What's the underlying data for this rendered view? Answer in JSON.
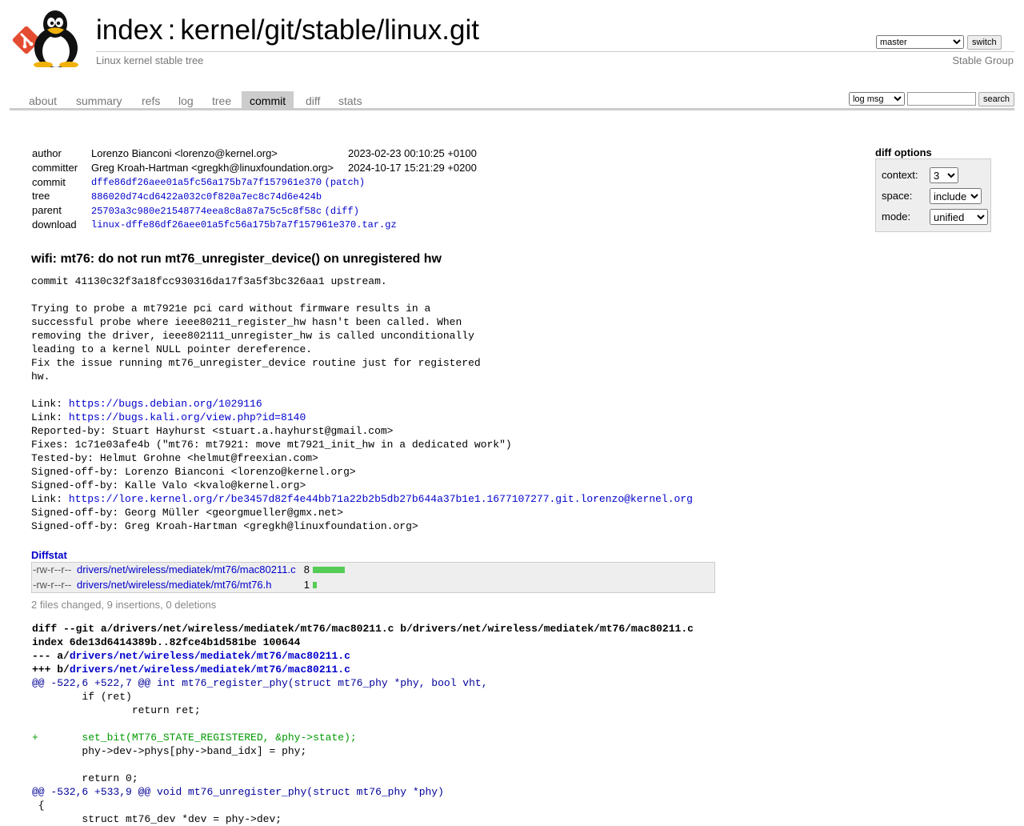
{
  "header": {
    "title_index": "index",
    "title_sep": ":",
    "title_repo": "kernel/git/stable/linux.git",
    "subtitle": "Linux kernel stable tree",
    "owner": "Stable Group",
    "branch_selected": "master",
    "switch_label": "switch"
  },
  "tabs": [
    {
      "label": "about"
    },
    {
      "label": "summary"
    },
    {
      "label": "refs"
    },
    {
      "label": "log"
    },
    {
      "label": "tree"
    },
    {
      "label": "commit"
    },
    {
      "label": "diff"
    },
    {
      "label": "stats"
    }
  ],
  "search": {
    "mode_selected": "log msg",
    "query": "",
    "button_label": "search"
  },
  "commit_info": {
    "author": {
      "label": "author",
      "value": "Lorenzo Bianconi <lorenzo@kernel.org>",
      "date": "2023-02-23 00:10:25 +0100"
    },
    "committer": {
      "label": "committer",
      "value": "Greg Kroah-Hartman <gregkh@linuxfoundation.org>",
      "date": "2024-10-17 15:21:29 +0200"
    },
    "commit": {
      "label": "commit",
      "hash": "dffe86df26aee01a5fc56a175b7a7f157961e370",
      "extra": "patch"
    },
    "tree": {
      "label": "tree",
      "hash": "886020d74cd6422a032c0f820a7ec8c74d6e424b"
    },
    "parent": {
      "label": "parent",
      "hash": "25703a3c980e21548774eea8c8a87a75c5c8f58c",
      "extra": "diff"
    },
    "download": {
      "label": "download",
      "file": "linux-dffe86df26aee01a5fc56a175b7a7f157961e370.tar.gz"
    }
  },
  "diff_options": {
    "title": "diff options",
    "context_label": "context:",
    "context_value": "3",
    "space_label": "space:",
    "space_value": "include",
    "mode_label": "mode:",
    "mode_value": "unified"
  },
  "subject": "wifi: mt76: do not run mt76_unregister_device() on unregistered hw",
  "message_lines": [
    "commit 41130c32f3a18fcc930316da17f3a5f3bc326aa1 upstream.",
    "",
    "Trying to probe a mt7921e pci card without firmware results in a",
    "successful probe where ieee80211_register_hw hasn't been called. When",
    "removing the driver, ieee802111_unregister_hw is called unconditionally",
    "leading to a kernel NULL pointer dereference.",
    "Fix the issue running mt76_unregister_device routine just for registered",
    "hw.",
    "",
    "Link: |https://bugs.debian.org/1029116",
    "Link: |https://bugs.kali.org/view.php?id=8140",
    "Reported-by: Stuart Hayhurst <stuart.a.hayhurst@gmail.com>",
    "Fixes: 1c71e03afe4b (\"mt76: mt7921: move mt7921_init_hw in a dedicated work\")",
    "Tested-by: Helmut Grohne <helmut@freexian.com>",
    "Signed-off-by: Lorenzo Bianconi <lorenzo@kernel.org>",
    "Signed-off-by: Kalle Valo <kvalo@kernel.org>",
    "Link: |https://lore.kernel.org/r/be3457d82f4e44bb71a22b2b5db27b644a37b1e1.1677107277.git.lorenzo@kernel.org",
    "Signed-off-by: Georg Müller <georgmueller@gmx.net>",
    "Signed-off-by: Greg Kroah-Hartman <gregkh@linuxfoundation.org>"
  ],
  "diffstat": {
    "title": "Diffstat",
    "files": [
      {
        "mode": "-rw-r--r--",
        "path": "drivers/net/wireless/mediatek/mt76/mac80211.c",
        "count": "8",
        "insertions": 8
      },
      {
        "mode": "-rw-r--r--",
        "path": "drivers/net/wireless/mediatek/mt76/mt76.h",
        "count": "1",
        "insertions": 1
      }
    ],
    "summary": "2 files changed, 9 insertions, 0 deletions",
    "bar_color": "#55cc55"
  },
  "diff_lines": [
    {
      "type": "head",
      "text": "diff --git a/drivers/net/wireless/mediatek/mt76/mac80211.c b/drivers/net/wireless/mediatek/mt76/mac80211.c"
    },
    {
      "type": "head",
      "text": "index 6de13d6414389b..82fce4b1d581be 100644"
    },
    {
      "type": "head-file",
      "prefix": "--- a/",
      "text": "drivers/net/wireless/mediatek/mt76/mac80211.c"
    },
    {
      "type": "head-file",
      "prefix": "+++ b/",
      "text": "drivers/net/wireless/mediatek/mt76/mac80211.c"
    },
    {
      "type": "hunk",
      "text": "@@ -522,6 +522,7 @@",
      "fn": " int mt76_register_phy(struct mt76_phy *phy, bool vht,"
    },
    {
      "type": "ctx",
      "text": " \tif (ret)"
    },
    {
      "type": "ctx",
      "text": " \t\treturn ret;"
    },
    {
      "type": "ctx",
      "text": " "
    },
    {
      "type": "add",
      "text": "+\tset_bit(MT76_STATE_REGISTERED, &phy->state);"
    },
    {
      "type": "ctx",
      "text": " \tphy->dev->phys[phy->band_idx] = phy;"
    },
    {
      "type": "ctx",
      "text": " "
    },
    {
      "type": "ctx",
      "text": " \treturn 0;"
    },
    {
      "type": "hunk",
      "text": "@@ -532,6 +533,9 @@",
      "fn": " void mt76_unregister_phy(struct mt76_phy *phy)"
    },
    {
      "type": "ctx",
      "text": " {"
    },
    {
      "type": "ctx",
      "text": " \tstruct mt76_dev *dev = phy->dev;"
    }
  ]
}
